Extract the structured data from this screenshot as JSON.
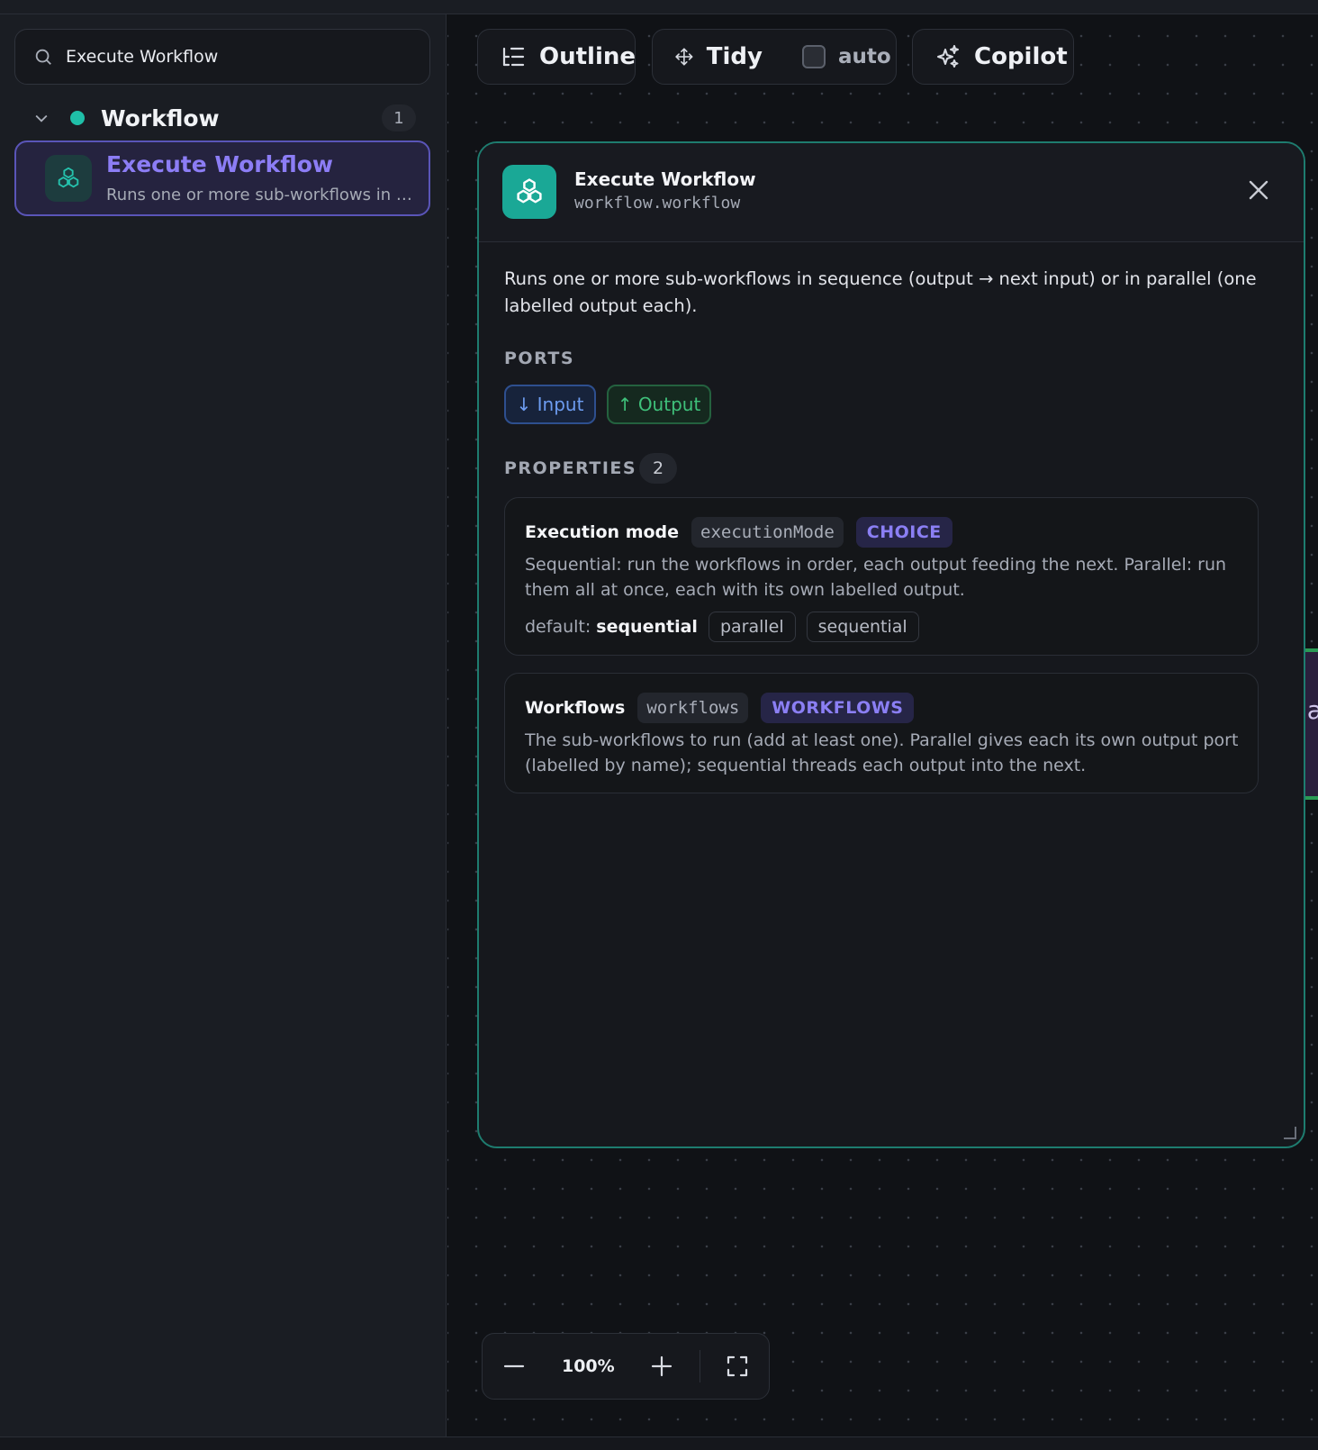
{
  "sidebar": {
    "search": {
      "value": "Execute Workflow",
      "icon": "search-icon"
    },
    "group": {
      "name": "Workflow",
      "count": "1",
      "dot_color": "#1fbfa8"
    },
    "items": [
      {
        "title": "Execute Workflow",
        "description": "Runs one or more sub-workflows in sequence (output → next input) or in parallel (one labelled output each).",
        "icon": "cubes-icon"
      }
    ]
  },
  "toolbar": {
    "outline_label": "Outline",
    "tidy_label": "Tidy",
    "auto_label": "auto",
    "copilot_label": "Copilot"
  },
  "panel": {
    "title": "Execute Workflow",
    "subtitle": "workflow.workflow",
    "description": "Runs one or more sub-workflows in sequence (output → next input) or in parallel (one labelled output each).",
    "ports_heading": "PORTS",
    "ports": {
      "input": "↓ Input",
      "output": "↑ Output"
    },
    "properties_heading": "PROPERTIES",
    "properties_count": "2",
    "properties": [
      {
        "name": "Execution mode",
        "key": "executionMode",
        "type": "CHOICE",
        "description": "Sequential: run the workflows in order, each output feeding the next. Parallel: run them all at once, each with its own labelled output.",
        "default_label": "default:",
        "default_value": "sequential",
        "options": [
          "parallel",
          "sequential"
        ]
      },
      {
        "name": "Workflows",
        "key": "workflows",
        "type": "WORKFLOWS",
        "description": "The sub-workflows to run (add at least one). Parallel gives each its own output port (labelled by name); sequential threads each output into the next."
      }
    ]
  },
  "edge_node": {
    "partial_text": "la"
  },
  "zoom": {
    "level": "100%"
  },
  "colors": {
    "accent": "#8c7df5",
    "teal": "#1aa896",
    "border_teal": "#1e7c6f"
  }
}
